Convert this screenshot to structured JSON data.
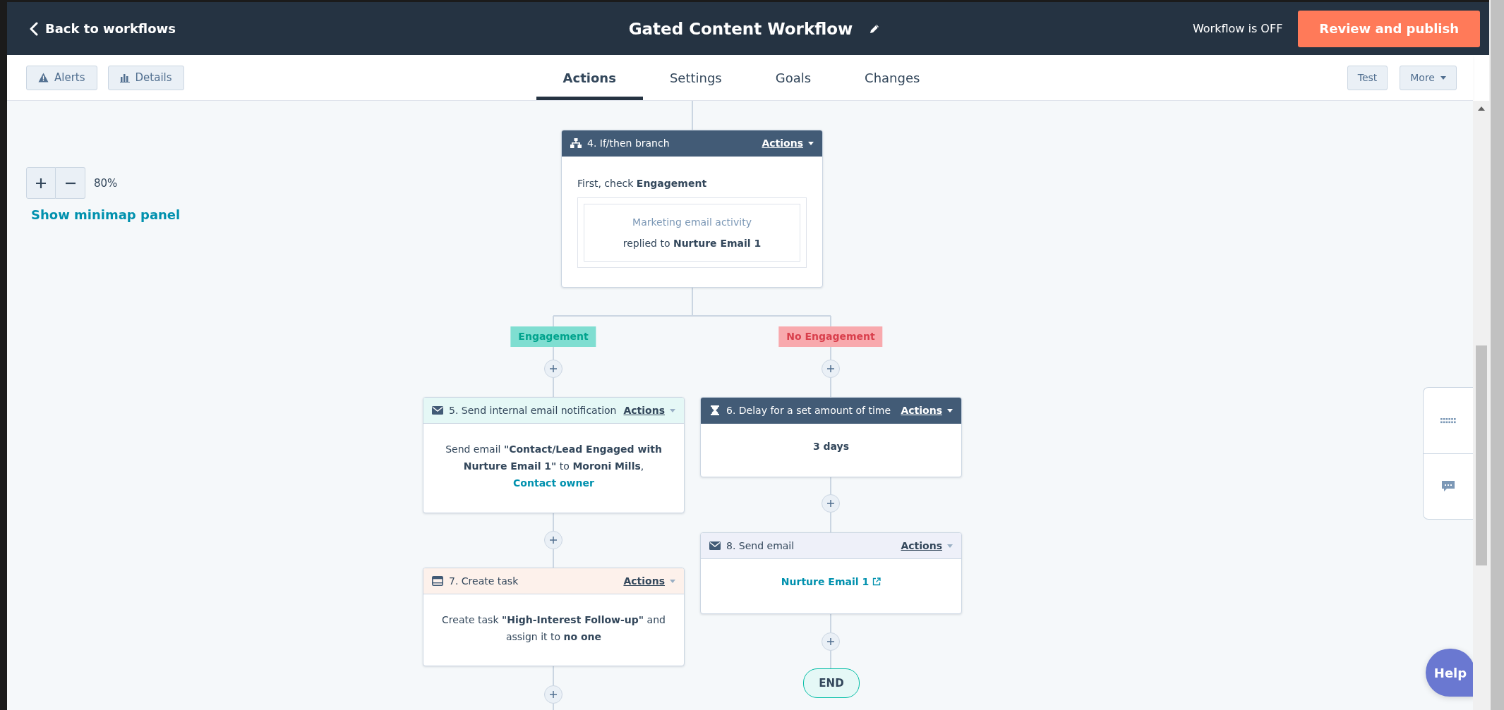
{
  "header": {
    "back_link": "Back to workflows",
    "title": "Gated Content Workflow",
    "status": "Workflow is OFF",
    "publish_button": "Review and publish"
  },
  "toolbar": {
    "left_buttons": [
      {
        "label": "Alerts",
        "kind": "alerts"
      },
      {
        "label": "Details",
        "kind": "details"
      }
    ],
    "tabs": [
      {
        "label": "Actions",
        "selected": true
      },
      {
        "label": "Settings",
        "selected": false
      },
      {
        "label": "Goals",
        "selected": false
      },
      {
        "label": "Changes",
        "selected": false
      }
    ],
    "right_buttons": [
      {
        "label": "Test",
        "kind": "plain"
      },
      {
        "label": "More",
        "kind": "dropdown"
      }
    ]
  },
  "zoom": {
    "level_text": "80%"
  },
  "minimap_link": "Show minimap panel",
  "nodes": [
    {
      "kind": "branch",
      "title": "4. If/then branch",
      "actions": "Actions",
      "intro": "First, check **Engagement**",
      "filter": {
        "property": "Marketing email activity",
        "condition": "replied to **Nurture Email 1**"
      }
    },
    {
      "kind": "internal_email",
      "title": "5. Send internal email notification",
      "actions": "Actions",
      "text": "Send email **\"Contact/Lead Engaged with Nurture Email 1\"** to **Moroni Mills**,",
      "link": "Contact owner"
    },
    {
      "kind": "delay",
      "title": "6. Delay for a set amount of time",
      "actions": "Actions",
      "text": "3 days"
    },
    {
      "kind": "task",
      "title": "7. Create task",
      "actions": "Actions",
      "text": "Create task **\"High-Interest Follow-up\"** and assign it to **no one**"
    },
    {
      "kind": "email",
      "title": "8. Send email",
      "actions": "Actions",
      "link": "Nurture Email 1"
    }
  ],
  "branch_labels": [
    {
      "label": "Engagement",
      "kind": "match"
    },
    {
      "label": "No Engagement",
      "kind": "no_match"
    }
  ],
  "end_label": "END",
  "help_button": "Help"
}
